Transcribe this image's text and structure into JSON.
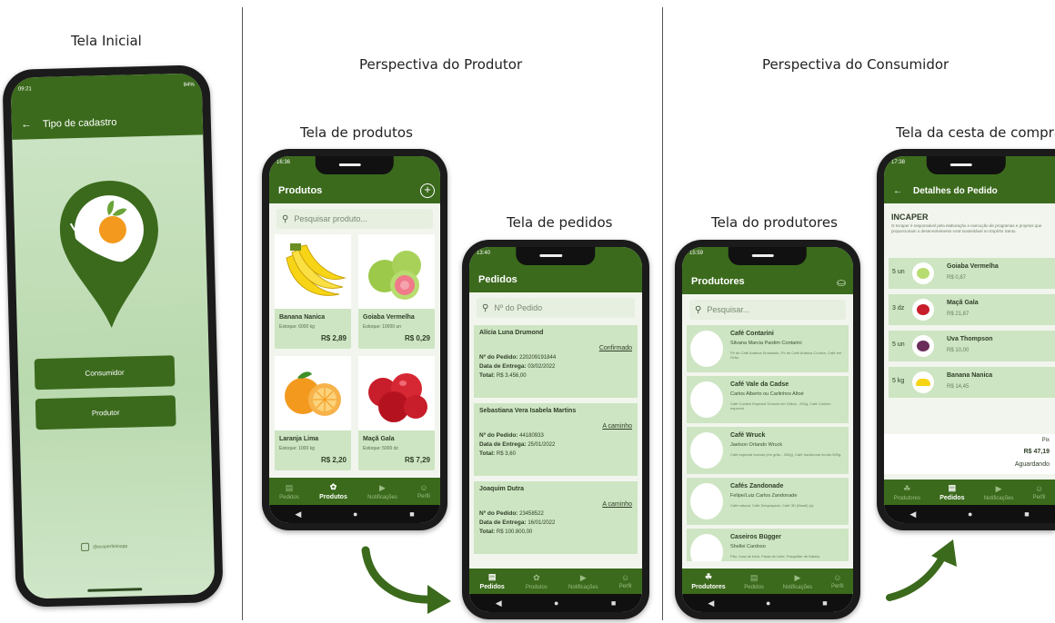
{
  "captions": {
    "initial": "Tela Inicial",
    "producer_perspective": "Perspectiva do Produtor",
    "consumer_perspective": "Perspectiva do Consumidor",
    "products_screen": "Tela de produtos",
    "orders_screen": "Tela de pedidos",
    "producers_screen": "Tela do produtores",
    "basket_screen": "Tela da cesta de compra"
  },
  "colors": {
    "primary": "#3b6a1c",
    "card": "#cde5c2",
    "accent_orange": "#f39a1e"
  },
  "screen1": {
    "time": "09:21",
    "battery": "84%",
    "title": "Tipo de cadastro",
    "buttons": [
      "Consumidor",
      "Produtor"
    ],
    "footer": "@ecoperfeitoapp"
  },
  "screen2": {
    "time": "16:36",
    "title": "Produtos",
    "search_placeholder": "Pesquisar produto...",
    "products": [
      {
        "name": "Banana Nanica",
        "stock": "Estoque: 6000 kg",
        "price": "R$ 2,89",
        "icon": "banana-icon"
      },
      {
        "name": "Goiaba Vermelha",
        "stock": "Estoque: 10000 un",
        "price": "R$ 0,29",
        "icon": "guava-icon"
      },
      {
        "name": "Laranja Lima",
        "stock": "Estoque: 1000 kg",
        "price": "R$ 2,20",
        "icon": "orange-icon"
      },
      {
        "name": "Maçã Gala",
        "stock": "Estoque: 5000 dz",
        "price": "R$ 7,29",
        "icon": "apple-icon"
      }
    ],
    "nav": [
      "Pedidos",
      "Produtos",
      "Notificações",
      "Perfil"
    ]
  },
  "screen3": {
    "time": "13:40",
    "title": "Pedidos",
    "search_placeholder": "Nº do Pedido",
    "orders": [
      {
        "client": "Alícia Luna Drumond",
        "status": "Confirmado",
        "number": "220209191844",
        "date": "03/02/2022",
        "total": "R$ 3.456,00"
      },
      {
        "client": "Sebastiana Vera Isabela Martins",
        "status": "A caminho",
        "number": "44180933",
        "date": "25/01/2022",
        "total": "R$ 3,60"
      },
      {
        "client": "Joaquim Dutra",
        "status": "A caminho",
        "number": "23458522",
        "date": "16/01/2022",
        "total": "R$ 100.800,00"
      }
    ],
    "labels": {
      "number": "Nº do Pedido:",
      "date": "Data de Entrega:",
      "total": "Total:"
    },
    "nav": [
      "Pedidos",
      "Produtos",
      "Notificações",
      "Perfil"
    ]
  },
  "screen4": {
    "time": "15:59",
    "title": "Produtores",
    "search_placeholder": "Pesquisar...",
    "producers": [
      {
        "name": "Café Contarini",
        "owner": "Silvana Marcia Pardim Contarini",
        "desc": "Pó de Café Arábica Embalado, Pó de Café Arábica Conilon, Café em Grão."
      },
      {
        "name": "Café Vale da Cadse",
        "owner": "Carlos Alberto ou Carlinhos Altoé",
        "desc": "Café Conilon Especial Torrado em Grãos - 250g, Café Conilon especial."
      },
      {
        "name": "Café Wruck",
        "owner": "Jaelson Orlando Wruck",
        "desc": "Café especial torrado (em grão - 250g), Café tradicional moído 500g."
      },
      {
        "name": "Cafés Zandonade",
        "owner": "Felipe/Luiz Carlos Zandonade",
        "desc": "Café natural, Café Despolpado, Café 3D (Brasil) (s)."
      },
      {
        "name": "Caseiros Bügger",
        "owner": "Shellei Cardoso",
        "desc": "Pão, broa de fubá, Pasta de Leite, Pasquitier de Batata."
      }
    ],
    "nav": [
      "Produtores",
      "Pedidos",
      "Notificações",
      "Perfil"
    ]
  },
  "screen5": {
    "time": "17:38",
    "title": "Detalhes do Pedido",
    "producer": "INCAPER",
    "producer_desc": "O Incaper é responsável pela elaboração e execução de programas e projetos que proporcionam o desenvolvimento rural sustentável no Espírito Santo.",
    "items": [
      {
        "qty": "5 un",
        "name": "Goiaba Vermelha",
        "price": "R$ 0,87",
        "icon": "guava-icon"
      },
      {
        "qty": "3 dz",
        "name": "Maçã Gala",
        "price": "R$ 21,87",
        "icon": "apple-icon"
      },
      {
        "qty": "5 un",
        "name": "Uva Thompson",
        "price": "R$ 10,00",
        "icon": "grape-icon"
      },
      {
        "qty": "5 kg",
        "name": "Banana Nanica",
        "price": "R$ 14,45",
        "icon": "banana-icon"
      }
    ],
    "payment": "Pix",
    "total": "R$ 47,19",
    "status": "Aguardando",
    "nav": [
      "Produtores",
      "Pedidos",
      "Notificações",
      "Perfil"
    ]
  }
}
